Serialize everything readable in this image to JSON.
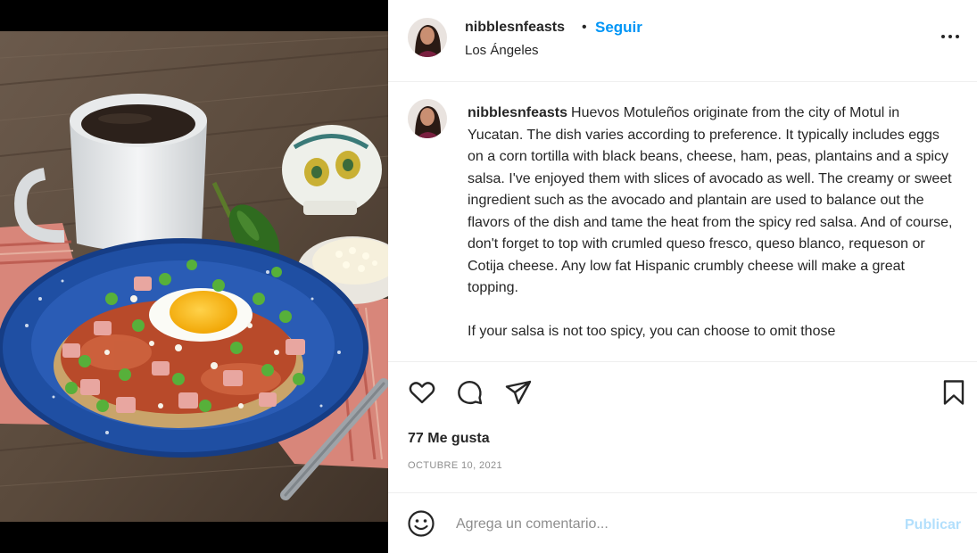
{
  "post": {
    "username": "nibblesnfeasts",
    "follow_label": "Seguir",
    "separator": "•",
    "location": "Los Ángeles"
  },
  "caption": {
    "username": "nibblesnfeasts",
    "text": "Huevos Motuleños originate from the city of Motul in Yucatan. The dish varies according to preference. It typically includes eggs on a corn tortilla with black beans, cheese, ham, peas, plantains and a spicy salsa. I've enjoyed them with slices of avocado as well. The creamy or sweet ingredient such as the avocado and plantain are used to balance out the flavors of the dish and tame the heat from the spicy red salsa. And of course, don't forget to top with crumled queso fresco, queso blanco, requeson or Cotija cheese. Any low fat Hispanic crumbly cheese will make a great topping.",
    "text2": "If your salsa is not too spicy, you can choose to omit those"
  },
  "stats": {
    "likes": "77 Me gusta",
    "date": "OCTUBRE 10, 2021"
  },
  "comment": {
    "placeholder": "Agrega un comentario...",
    "publish_label": "Publicar"
  },
  "icons": {
    "more": "more-options-icon",
    "like": "heart-icon",
    "comment": "comment-icon",
    "share": "send-icon",
    "save": "bookmark-icon",
    "emoji": "emoji-icon"
  },
  "colors": {
    "link": "#0095f6",
    "publish_disabled": "#b2dffc",
    "muted": "#8e8e8e",
    "text": "#262626"
  }
}
